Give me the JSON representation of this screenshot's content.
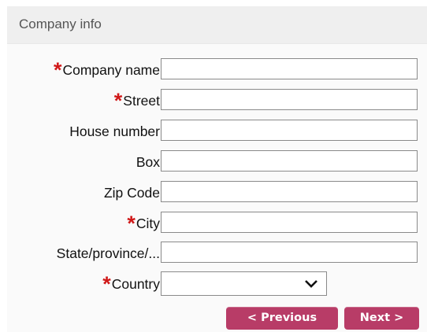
{
  "header": {
    "title": "Company info"
  },
  "form": {
    "required_marker": "*",
    "fields": [
      {
        "label": "Company name",
        "required": true,
        "value": ""
      },
      {
        "label": "Street",
        "required": true,
        "value": ""
      },
      {
        "label": "House number",
        "required": false,
        "value": ""
      },
      {
        "label": "Box",
        "required": false,
        "value": ""
      },
      {
        "label": "Zip Code",
        "required": false,
        "value": ""
      },
      {
        "label": "City",
        "required": true,
        "value": ""
      },
      {
        "label": "State/province/...",
        "required": false,
        "value": ""
      }
    ],
    "country": {
      "label": "Country",
      "required": true,
      "selected": ""
    }
  },
  "buttons": {
    "previous": "< Previous",
    "next": "Next >"
  },
  "colors": {
    "required": "#d01818",
    "button_bg": "#b83c67",
    "header_bg": "#efefef"
  },
  "icons": {
    "select_arrow": "chevron-down-icon"
  }
}
